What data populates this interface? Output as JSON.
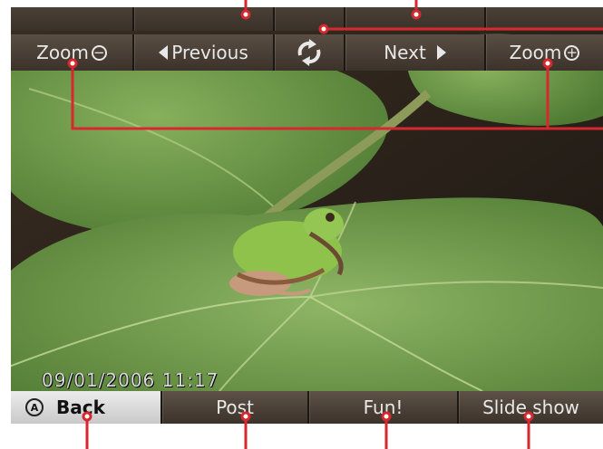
{
  "photo": {
    "timestamp": "09/01/2006 11:17"
  },
  "top_toolbar": {
    "zoom_out_label": "Zoom",
    "zoom_out_symbol": "−",
    "previous_label": "Previous",
    "rotate_icon": "rotate-arrows-icon",
    "next_label": "Next",
    "zoom_in_label": "Zoom",
    "zoom_in_symbol": "+"
  },
  "bottom_toolbar": {
    "back_badge": "A",
    "back_label": "Back",
    "post_label": "Post",
    "fun_label": "Fun!",
    "slideshow_label": "Slide show"
  },
  "colors": {
    "toolbar_bg": "#4a3f35",
    "back_button_bg": "#e0e0e0",
    "callout_red": "#d7282f",
    "leaf_green": "#6f9a4a",
    "frog_green": "#8ec24a"
  }
}
